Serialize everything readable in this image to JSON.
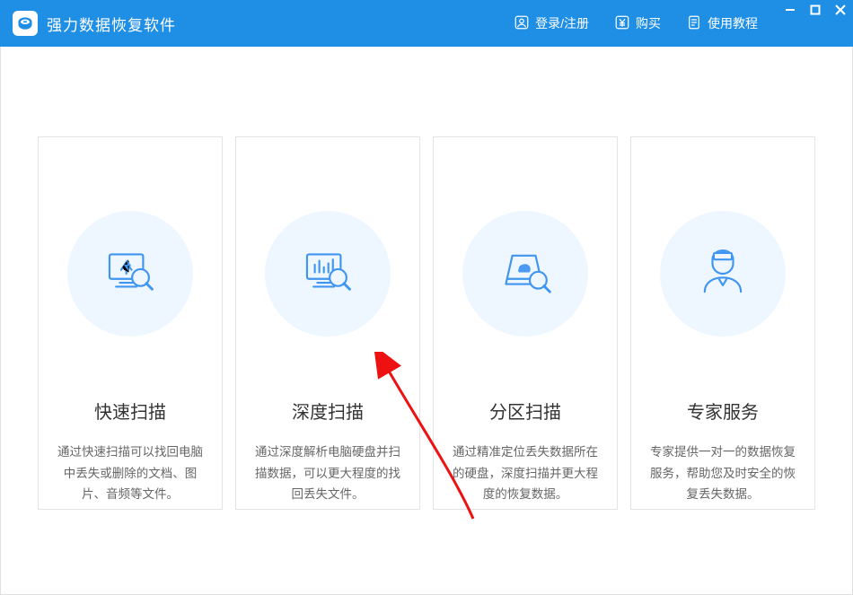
{
  "app": {
    "title": "强力数据恢复软件"
  },
  "top": {
    "login": "登录/注册",
    "buy": "购买",
    "tutorial": "使用教程"
  },
  "cards": [
    {
      "title": "快速扫描",
      "desc": "通过快速扫描可以找回电脑中丢失或删除的文档、图片、音频等文件。"
    },
    {
      "title": "深度扫描",
      "desc": "通过深度解析电脑硬盘并扫描数据，可以更大程度的找回丢失文件。"
    },
    {
      "title": "分区扫描",
      "desc": "通过精准定位丢失数据所在的硬盘，深度扫描并更大程度的恢复数据。"
    },
    {
      "title": "专家服务",
      "desc": "专家提供一对一的数据恢复服务，帮助您及时安全的恢复丢失数据。"
    }
  ]
}
